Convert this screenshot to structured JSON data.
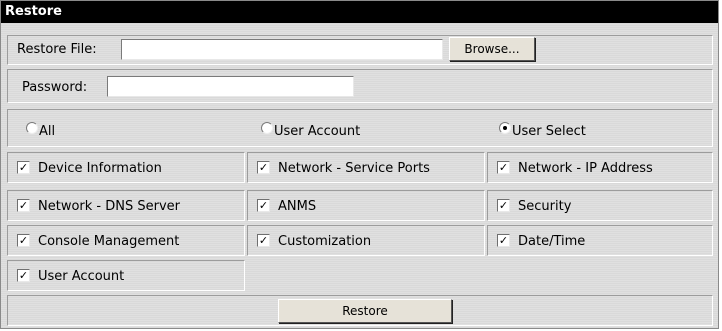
{
  "window": {
    "title": "Restore"
  },
  "restore_file": {
    "label": "Restore File:",
    "value": "",
    "browse_label": "Browse..."
  },
  "password": {
    "label": "Password:",
    "value": ""
  },
  "mode": {
    "options": [
      "All",
      "User Account",
      "User Select"
    ],
    "selected": "User Select"
  },
  "items": [
    {
      "label": "Device Information",
      "checked": true
    },
    {
      "label": "Network - Service Ports",
      "checked": true
    },
    {
      "label": "Network - IP Address",
      "checked": true
    },
    {
      "label": "Network - DNS Server",
      "checked": true
    },
    {
      "label": "ANMS",
      "checked": true
    },
    {
      "label": "Security",
      "checked": true
    },
    {
      "label": "Console Management",
      "checked": true
    },
    {
      "label": "Customization",
      "checked": true
    },
    {
      "label": "Date/Time",
      "checked": true
    },
    {
      "label": "User Account",
      "checked": true
    }
  ],
  "actions": {
    "restore_label": "Restore"
  }
}
